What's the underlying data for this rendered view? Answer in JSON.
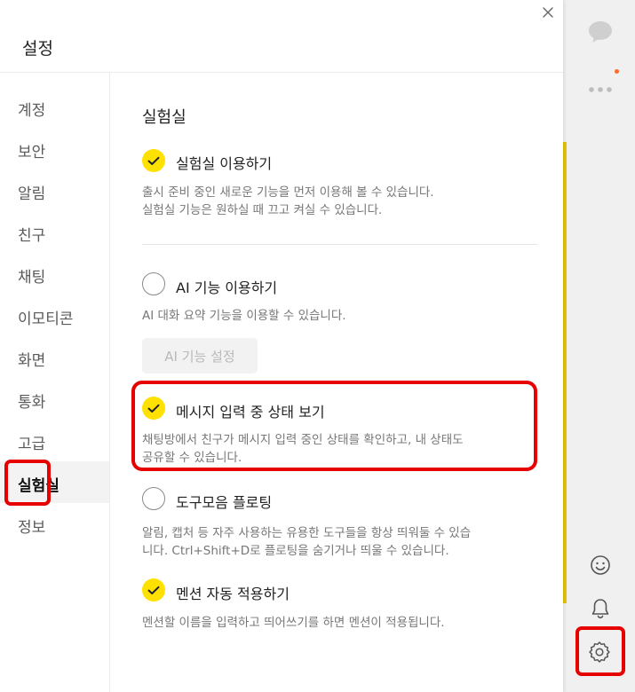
{
  "dialog": {
    "title": "설정"
  },
  "sidebar": {
    "items": [
      {
        "label": "계정"
      },
      {
        "label": "보안"
      },
      {
        "label": "알림"
      },
      {
        "label": "친구"
      },
      {
        "label": "채팅"
      },
      {
        "label": "이모티콘"
      },
      {
        "label": "화면"
      },
      {
        "label": "통화"
      },
      {
        "label": "고급"
      },
      {
        "label": "실험실",
        "active": true
      },
      {
        "label": "정보"
      }
    ]
  },
  "lab": {
    "title": "실험실",
    "options": [
      {
        "label": "실험실 이용하기",
        "checked": true,
        "desc_lines": [
          "출시 준비 중인 새로운 기능을 먼저 이용해 볼 수 있습니다.",
          "실험실 기능은 원하실 때 끄고 켜실 수 있습니다."
        ]
      },
      {
        "label": "AI 기능 이용하기",
        "checked": false,
        "desc_lines": [
          "AI 대화 요약 기능을 이용할 수 있습니다."
        ],
        "button": "AI 기능 설정"
      },
      {
        "label": "메시지 입력 중 상태 보기",
        "checked": true,
        "desc_lines": [
          "채팅방에서 친구가 메시지 입력 중인 상태를 확인하고, 내 상태도",
          "공유할 수 있습니다."
        ]
      },
      {
        "label": "도구모음 플로팅",
        "checked": false,
        "desc_lines": [
          "알림, 캡처 등 자주 사용하는 유용한 도구들을 항상 띄워둘 수 있습",
          "니다. Ctrl+Shift+D로 플로팅을 숨기거나 띄울 수 있습니다."
        ]
      },
      {
        "label": "멘션 자동 적용하기",
        "checked": true,
        "desc_lines": [
          "멘션할 이름을 입력하고 띄어쓰기를 하면 멘션이 적용됩니다."
        ]
      }
    ]
  },
  "right_bar": {
    "icons": [
      "chat-bubble-icon",
      "more-icon",
      "emoticon-icon",
      "bell-icon",
      "gear-icon"
    ],
    "colors": {
      "accent": "#ffe100",
      "highlight": "#e60000",
      "badge": "#ff6b2c"
    }
  }
}
